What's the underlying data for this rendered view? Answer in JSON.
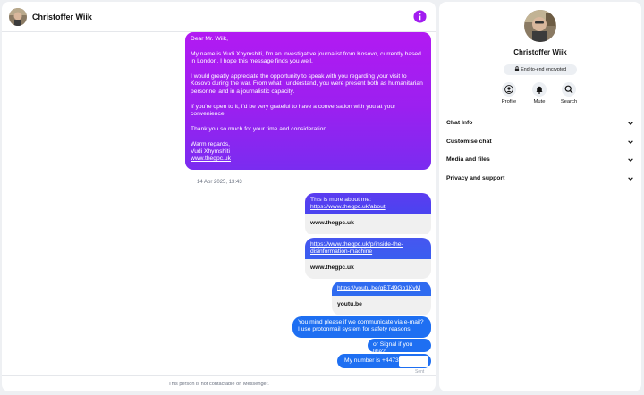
{
  "contact": {
    "name": "Christoffer Wiik"
  },
  "messages": {
    "intro": {
      "greeting": "Dear Mr. Wiik,",
      "para1": "My name is Vudi Xhymshiti, I'm an investigative journalist from Kosovo, currently based in London. I hope this message finds you well.",
      "para2": "I would greatly appreciate the opportunity to speak with you regarding your visit to Kosovo during the war. From what I understand, you were present both as humanitarian personnel and in a journalistic capacity.",
      "para3": "If you're open to it, I'd be very grateful to have a conversation with you at your convenience.",
      "para4": "Thank you so much for your time and consideration.",
      "sign1": "Warm regards,",
      "sign2": "Vudi Xhymshiti",
      "link": "www.thegpc.uk"
    },
    "timestamp": "14 Apr 2025, 13:43",
    "card1": {
      "text": "This is more about me:",
      "link": "https://www.thegpc.uk/about",
      "domain": "www.thegpc.uk"
    },
    "card2": {
      "link": "https://www.thegpc.uk/p/inside-the-disinformation-machine",
      "domain": "www.thegpc.uk"
    },
    "card3": {
      "link": "https://youtu.be/gBT49Gb1KvM",
      "domain": "youtu.be"
    },
    "mail": "You mind please if we communicate via e-mail? I use protonmail system for safety reasons",
    "signal": "or Signal if you like?",
    "number": "My number is +4473",
    "status": "Sent"
  },
  "footer": "This person is not contactable on Messenger.",
  "panel": {
    "name": "Christoffer Wiik",
    "encryption": "End-to-end encrypted",
    "actions": {
      "profile": "Profile",
      "mute": "Mute",
      "search": "Search"
    },
    "sections": [
      "Chat Info",
      "Customise chat",
      "Media and files",
      "Privacy and support"
    ]
  },
  "colors": {
    "accent": "#a21cf0",
    "blue_bubble": "#1e6ff2"
  }
}
